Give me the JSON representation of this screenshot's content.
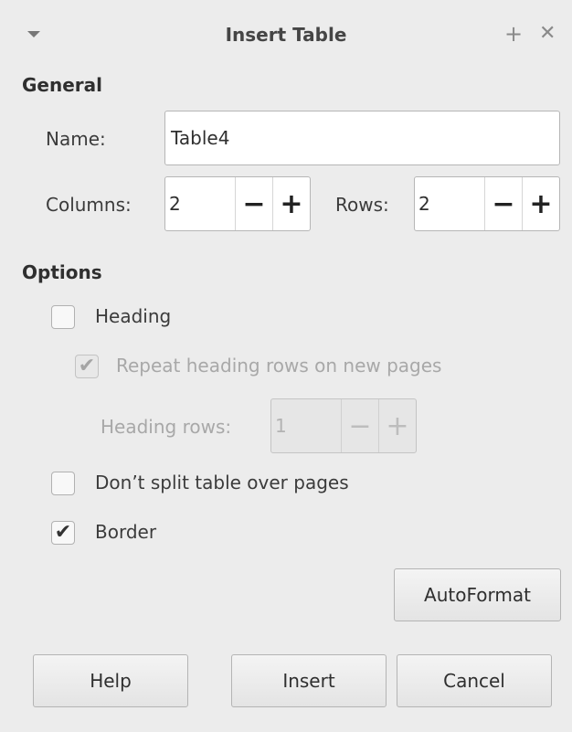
{
  "window": {
    "title": "Insert Table",
    "add_label": "+",
    "close_label": "✕"
  },
  "general": {
    "heading": "General",
    "name_label": "Name:",
    "name_value": "Table4",
    "columns_label": "Columns:",
    "columns_value": "2",
    "rows_label": "Rows:",
    "rows_value": "2",
    "minus": "−",
    "plus": "+"
  },
  "options": {
    "heading": "Options",
    "heading_checkbox": {
      "label": "Heading",
      "checked": false
    },
    "repeat_heading": {
      "label": "Repeat heading rows on new pages",
      "checked": true,
      "enabled": false
    },
    "heading_rows_label": "Heading rows:",
    "heading_rows_value": "1",
    "dont_split": {
      "label": "Don’t split table over pages",
      "checked": false
    },
    "border": {
      "label": "Border",
      "checked": true
    },
    "check_mark": "✔"
  },
  "buttons": {
    "autoformat": "AutoFormat",
    "help": "Help",
    "insert": "Insert",
    "cancel": "Cancel"
  }
}
